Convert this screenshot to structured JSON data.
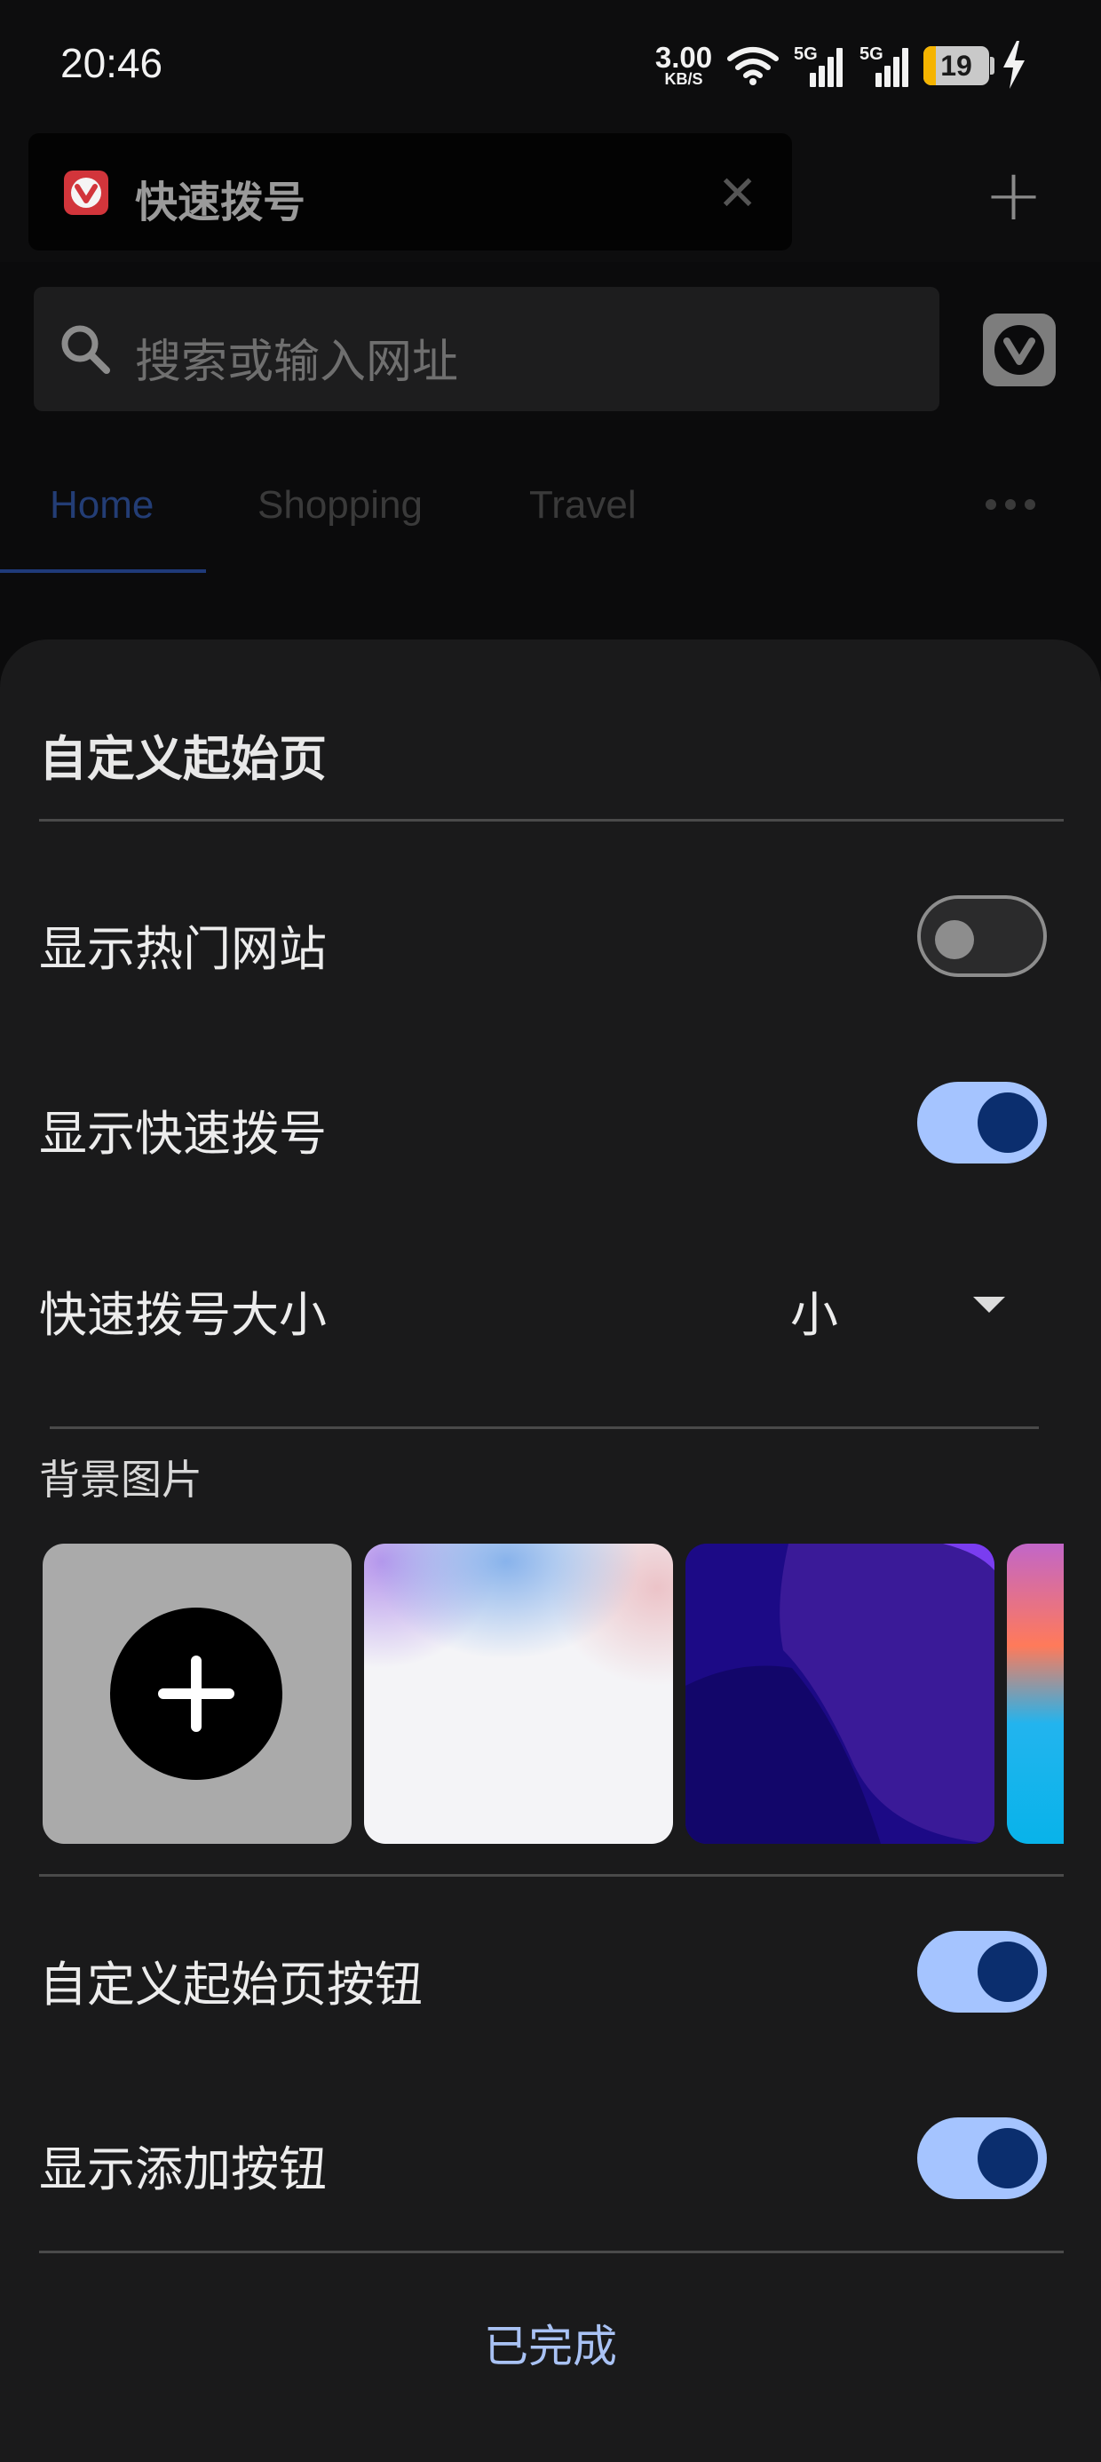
{
  "status_bar": {
    "time": "20:46",
    "net_speed_value": "3.00",
    "net_speed_unit": "KB/S",
    "sim1_type": "5G",
    "sim2_type": "5G",
    "battery_level": "19",
    "icons": [
      "wifi-icon",
      "signal-icon",
      "signal-icon",
      "battery-icon",
      "charging-icon"
    ]
  },
  "tab_strip": {
    "active_tab_title": "快速拨号",
    "favicon": "vivaldi-logo-icon",
    "close_icon": "close-icon",
    "new_tab_icon": "plus-icon"
  },
  "address_bar": {
    "placeholder": "搜索或输入网址",
    "search_icon": "search-icon",
    "menu_icon": "vivaldi-menu-icon"
  },
  "category_tabs": {
    "items": [
      {
        "label": "Home",
        "active": true
      },
      {
        "label": "Shopping",
        "active": false
      },
      {
        "label": "Travel",
        "active": false
      }
    ],
    "more_icon": "more-horizontal-icon"
  },
  "sheet": {
    "title": "自定义起始页",
    "show_top_sites": {
      "label": "显示热门网站",
      "enabled": false
    },
    "show_speed_dial": {
      "label": "显示快速拨号",
      "enabled": true
    },
    "speed_dial_size": {
      "label": "快速拨号大小",
      "value": "小"
    },
    "background": {
      "label": "背景图片",
      "thumbnails": [
        "add-background",
        "soft-pastel-gradient",
        "deep-blue-abstract",
        "sunset-ocean-gradient"
      ]
    },
    "customize_button": {
      "label": "自定义起始页按钮",
      "enabled": true
    },
    "show_add_button": {
      "label": "显示添加按钮",
      "enabled": true
    },
    "done_label": "已完成"
  },
  "colors": {
    "accent": "#a5c4ff",
    "toggle_knob_on": "#0b2e6e",
    "sheet_bg": "#1a1a1b",
    "battery_fill": "#f5b400"
  }
}
